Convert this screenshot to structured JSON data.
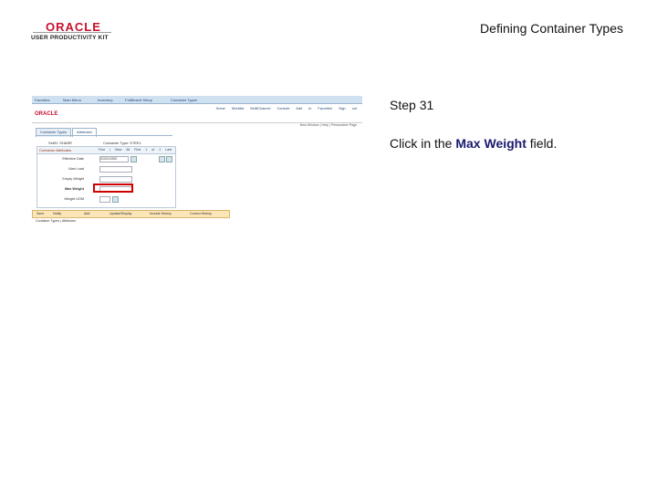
{
  "logo": {
    "brand": "ORACLE",
    "sub": "USER PRODUCTIVITY KIT"
  },
  "page_title": "Defining Container Types",
  "step_label": "Step 31",
  "instruction": {
    "prefix": "Click in the ",
    "target": "Max Weight",
    "suffix": " field."
  },
  "app": {
    "breadcrumbs": [
      "Favorites",
      "Main Menu",
      "Inventory",
      "Fulfillment Setup",
      "Container Types"
    ],
    "nav_links": [
      "Home",
      "Worklist",
      "MultiChannel Console",
      "Add to Favorites",
      "Sign out"
    ],
    "toolbar_links": "New Window | Help | Personalize Page",
    "tabs": [
      "Container Types",
      "Attributes"
    ],
    "setid_label": "SetID: SHARE",
    "container_type_label": "Container Type: STEEL",
    "section_title": "Container Attributes",
    "section_nav": "Find | View All First 1 of 1 Last",
    "fields": [
      {
        "label": "Effective Date",
        "value": "01/01/1900"
      },
      {
        "label": "Max Load",
        "value": ""
      },
      {
        "label": "Empty Weight",
        "value": ""
      },
      {
        "label": "Max Weight",
        "value": ""
      },
      {
        "label": "Weight UOM",
        "value": ""
      }
    ],
    "buttons": [
      "Save",
      "Notify",
      "Add",
      "Update/Display",
      "Include History",
      "Correct History"
    ],
    "footer_link": "Container Types | Attributes"
  }
}
